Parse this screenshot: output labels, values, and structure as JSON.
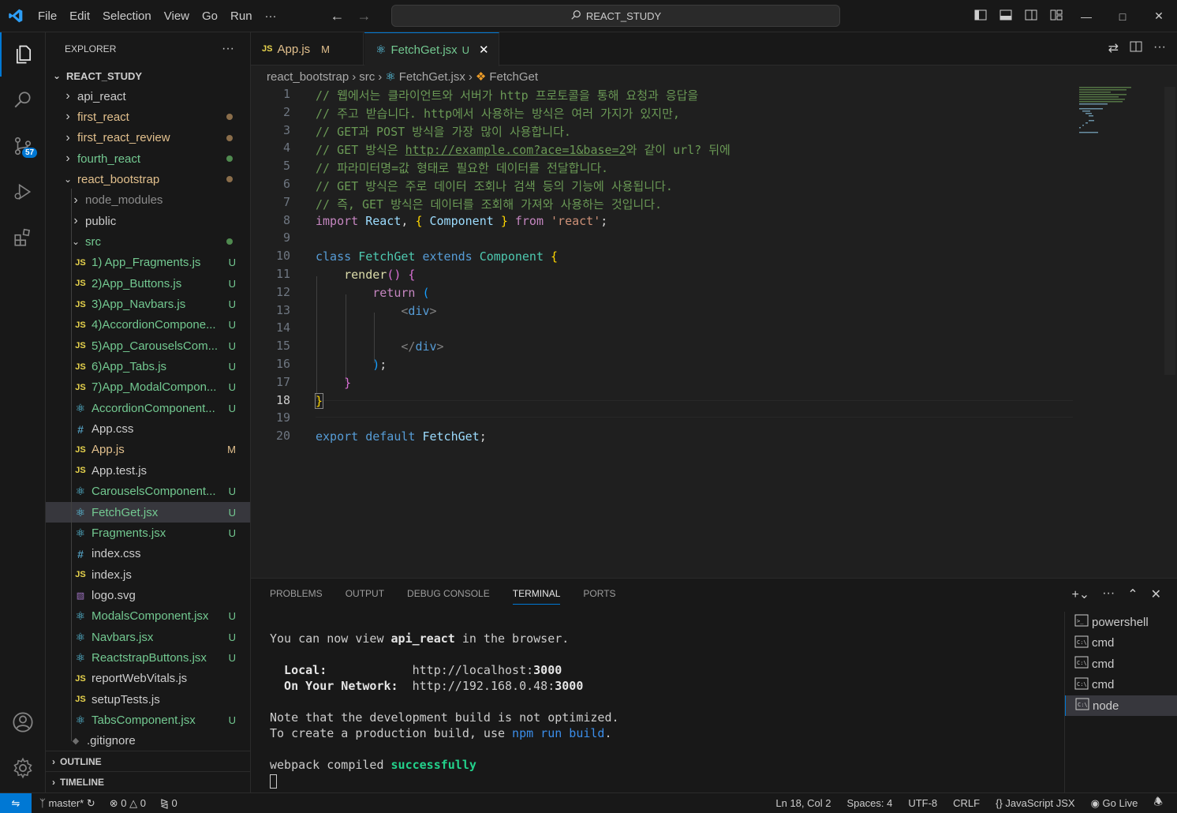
{
  "titlebar": {
    "menu": [
      "File",
      "Edit",
      "Selection",
      "View",
      "Go",
      "Run",
      "···"
    ],
    "search": "REACT_STUDY"
  },
  "activity": {
    "scm_badge": "57"
  },
  "explorer": {
    "title": "EXPLORER",
    "more": "···",
    "root": "REACT_STUDY",
    "items": [
      {
        "label": "api_react",
        "depth": 0,
        "kind": "folder",
        "open": false
      },
      {
        "label": "first_react",
        "depth": 0,
        "kind": "folder",
        "open": false,
        "dot": "#8a6d4a"
      },
      {
        "label": "first_react_review",
        "depth": 0,
        "kind": "folder",
        "open": false,
        "dot": "#8a6d4a"
      },
      {
        "label": "fourth_react",
        "depth": 0,
        "kind": "folder",
        "open": false,
        "dot": "#4f8a4f"
      },
      {
        "label": "react_bootstrap",
        "depth": 0,
        "kind": "folder",
        "open": true,
        "dot": "#8a6d4a"
      },
      {
        "label": "node_modules",
        "depth": 1,
        "kind": "folder",
        "open": false,
        "dim": true
      },
      {
        "label": "public",
        "depth": 1,
        "kind": "folder",
        "open": false
      },
      {
        "label": "src",
        "depth": 1,
        "kind": "folder",
        "open": true,
        "dot": "#4f8a4f"
      },
      {
        "label": "1) App_Fragments.js",
        "depth": 2,
        "kind": "js",
        "status": "U"
      },
      {
        "label": "2)App_Buttons.js",
        "depth": 2,
        "kind": "js",
        "status": "U"
      },
      {
        "label": "3)App_Navbars.js",
        "depth": 2,
        "kind": "js",
        "status": "U"
      },
      {
        "label": "4)AccordionCompone...",
        "depth": 2,
        "kind": "js",
        "status": "U"
      },
      {
        "label": "5)App_CarouselsCom...",
        "depth": 2,
        "kind": "js",
        "status": "U"
      },
      {
        "label": "6)App_Tabs.js",
        "depth": 2,
        "kind": "js",
        "status": "U"
      },
      {
        "label": "7)App_ModalCompon...",
        "depth": 2,
        "kind": "js",
        "status": "U"
      },
      {
        "label": "AccordionComponent...",
        "depth": 2,
        "kind": "jsx",
        "status": "U"
      },
      {
        "label": "App.css",
        "depth": 2,
        "kind": "css"
      },
      {
        "label": "App.js",
        "depth": 2,
        "kind": "js",
        "status": "M"
      },
      {
        "label": "App.test.js",
        "depth": 2,
        "kind": "js"
      },
      {
        "label": "CarouselsComponent...",
        "depth": 2,
        "kind": "jsx",
        "status": "U"
      },
      {
        "label": "FetchGet.jsx",
        "depth": 2,
        "kind": "jsx",
        "status": "U",
        "selected": true
      },
      {
        "label": "Fragments.jsx",
        "depth": 2,
        "kind": "jsx",
        "status": "U"
      },
      {
        "label": "index.css",
        "depth": 2,
        "kind": "css"
      },
      {
        "label": "index.js",
        "depth": 2,
        "kind": "js"
      },
      {
        "label": "logo.svg",
        "depth": 2,
        "kind": "svg"
      },
      {
        "label": "ModalsComponent.jsx",
        "depth": 2,
        "kind": "jsx",
        "status": "U"
      },
      {
        "label": "Navbars.jsx",
        "depth": 2,
        "kind": "jsx",
        "status": "U"
      },
      {
        "label": "ReactstrapButtons.jsx",
        "depth": 2,
        "kind": "jsx",
        "status": "U"
      },
      {
        "label": "reportWebVitals.js",
        "depth": 2,
        "kind": "js"
      },
      {
        "label": "setupTests.js",
        "depth": 2,
        "kind": "js"
      },
      {
        "label": "TabsComponent.jsx",
        "depth": 2,
        "kind": "jsx",
        "status": "U"
      },
      {
        "label": ".gitignore",
        "depth": 1,
        "kind": "git"
      }
    ],
    "outline": "OUTLINE",
    "timeline": "TIMELINE"
  },
  "tabs": [
    {
      "label": "App.js",
      "status": "M",
      "icon": "JS",
      "active": false
    },
    {
      "label": "FetchGet.jsx",
      "status": "U",
      "icon": "react",
      "active": true
    }
  ],
  "breadcrumb": [
    "react_bootstrap",
    "src",
    "FetchGet.jsx",
    "FetchGet"
  ],
  "editor": {
    "current_line": "18",
    "line_numbers": [
      "1",
      "2",
      "3",
      "4",
      "5",
      "6",
      "7",
      "8",
      "9",
      "10",
      "11",
      "12",
      "13",
      "14",
      "15",
      "16",
      "17",
      "18",
      "19",
      "20"
    ]
  },
  "panel": {
    "tabs": [
      "PROBLEMS",
      "OUTPUT",
      "DEBUG CONSOLE",
      "TERMINAL",
      "PORTS"
    ],
    "active_tab": "TERMINAL",
    "terminal": {
      "l1a": "You can now view ",
      "l1b": "api_react",
      "l1c": " in the browser.",
      "local_label": "  Local:",
      "local_url": "http://localhost:",
      "local_port": "3000",
      "net_label": "  On Your Network:",
      "net_url": "http://192.168.0.48:",
      "net_port": "3000",
      "l4": "Note that the development build is not optimized.",
      "l5a": "To create a production build, use ",
      "l5b": "npm run build",
      "l5c": ".",
      "l6a": "webpack compiled ",
      "l6b": "successfully"
    },
    "instances": [
      {
        "label": "powershell",
        "active": false
      },
      {
        "label": "cmd",
        "active": false
      },
      {
        "label": "cmd",
        "active": false
      },
      {
        "label": "cmd",
        "active": false
      },
      {
        "label": "node",
        "active": true
      }
    ]
  },
  "statusbar": {
    "branch": "master*",
    "errors": "0",
    "warnings": "0",
    "ports": "0",
    "position": "Ln 18, Col 2",
    "spaces": "Spaces: 4",
    "encoding": "UTF-8",
    "eol": "CRLF",
    "language": "JavaScript JSX",
    "golive": "Go Live"
  },
  "colors": {
    "accent": "#0078d4",
    "untracked": "#73c991",
    "modified": "#e2c08d"
  }
}
